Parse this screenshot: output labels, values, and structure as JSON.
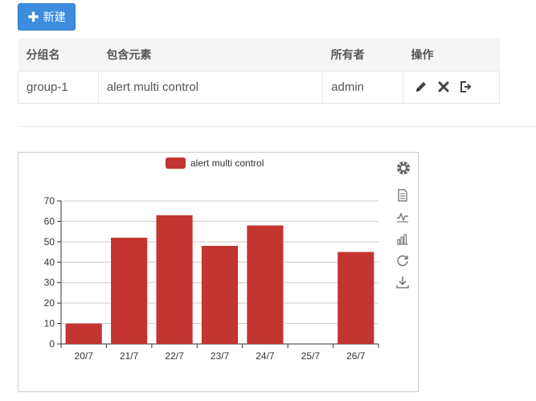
{
  "toolbar": {
    "new_label": "新建"
  },
  "table": {
    "headers": [
      "分组名",
      "包含元素",
      "所有者",
      "操作"
    ],
    "rows": [
      {
        "group": "group-1",
        "elements": "alert multi control",
        "owner": "admin"
      }
    ],
    "row_actions": [
      "edit-icon",
      "delete-icon",
      "logout-icon"
    ]
  },
  "toolbox_icons": [
    "settings-icon",
    "data-view-icon",
    "line-chart-icon",
    "bar-chart-icon",
    "refresh-icon",
    "download-icon"
  ],
  "colors": {
    "accent": "#3c8dde",
    "series": "#c23531"
  },
  "chart_data": {
    "type": "bar",
    "categories": [
      "20/7",
      "21/7",
      "22/7",
      "23/7",
      "24/7",
      "25/7",
      "26/7"
    ],
    "series": [
      {
        "name": "alert multi control",
        "values": [
          10,
          52,
          63,
          48,
          58,
          0,
          45
        ]
      }
    ],
    "ylim": [
      0,
      70
    ],
    "yticks": [
      0,
      10,
      20,
      30,
      40,
      50,
      60,
      70
    ],
    "legend_position": "top-center",
    "grid": "horizontal"
  }
}
